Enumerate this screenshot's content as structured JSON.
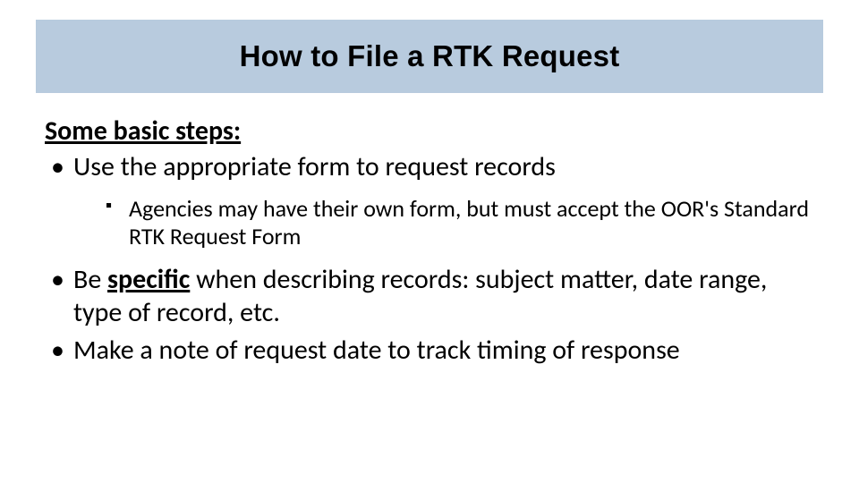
{
  "title": "How to File a RTK Request",
  "intro": "Some basic steps:",
  "bullets": {
    "b1": "Use the appropriate form to request records",
    "b1_sub": "Agencies may have their own form, but must accept the OOR's Standard RTK Request Form",
    "b2_pre": "Be ",
    "b2_specific": "specific",
    "b2_post": " when describing records: subject matter, date range, type of record, etc.",
    "b3": "Make a note of request date to track timing of response"
  }
}
